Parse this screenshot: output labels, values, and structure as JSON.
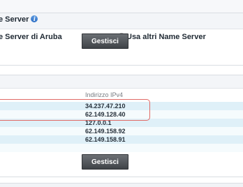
{
  "name_server_section": {
    "title": "e Server",
    "info_icon": "info-icon",
    "info_glyph": "i",
    "options": [
      {
        "label": "e Server di Aruba",
        "selected": true
      },
      {
        "label": "Usa altri Name Server",
        "selected": false
      }
    ],
    "button_label": "Gestisci"
  },
  "dns_section": {
    "column_header": "Indirizzo IPv4",
    "rows": [
      {
        "ipv4": "34.237.47.210",
        "highlighted": true
      },
      {
        "ipv4": "62.149.128.40",
        "highlighted": true
      },
      {
        "ipv4": "127.0.0.1",
        "highlighted": false
      },
      {
        "ipv4": "62.149.158.92",
        "highlighted": false
      },
      {
        "ipv4": "62.149.158.91",
        "highlighted": false
      }
    ],
    "button_label": "Gestisci",
    "highlight_color": "#e06a66"
  }
}
